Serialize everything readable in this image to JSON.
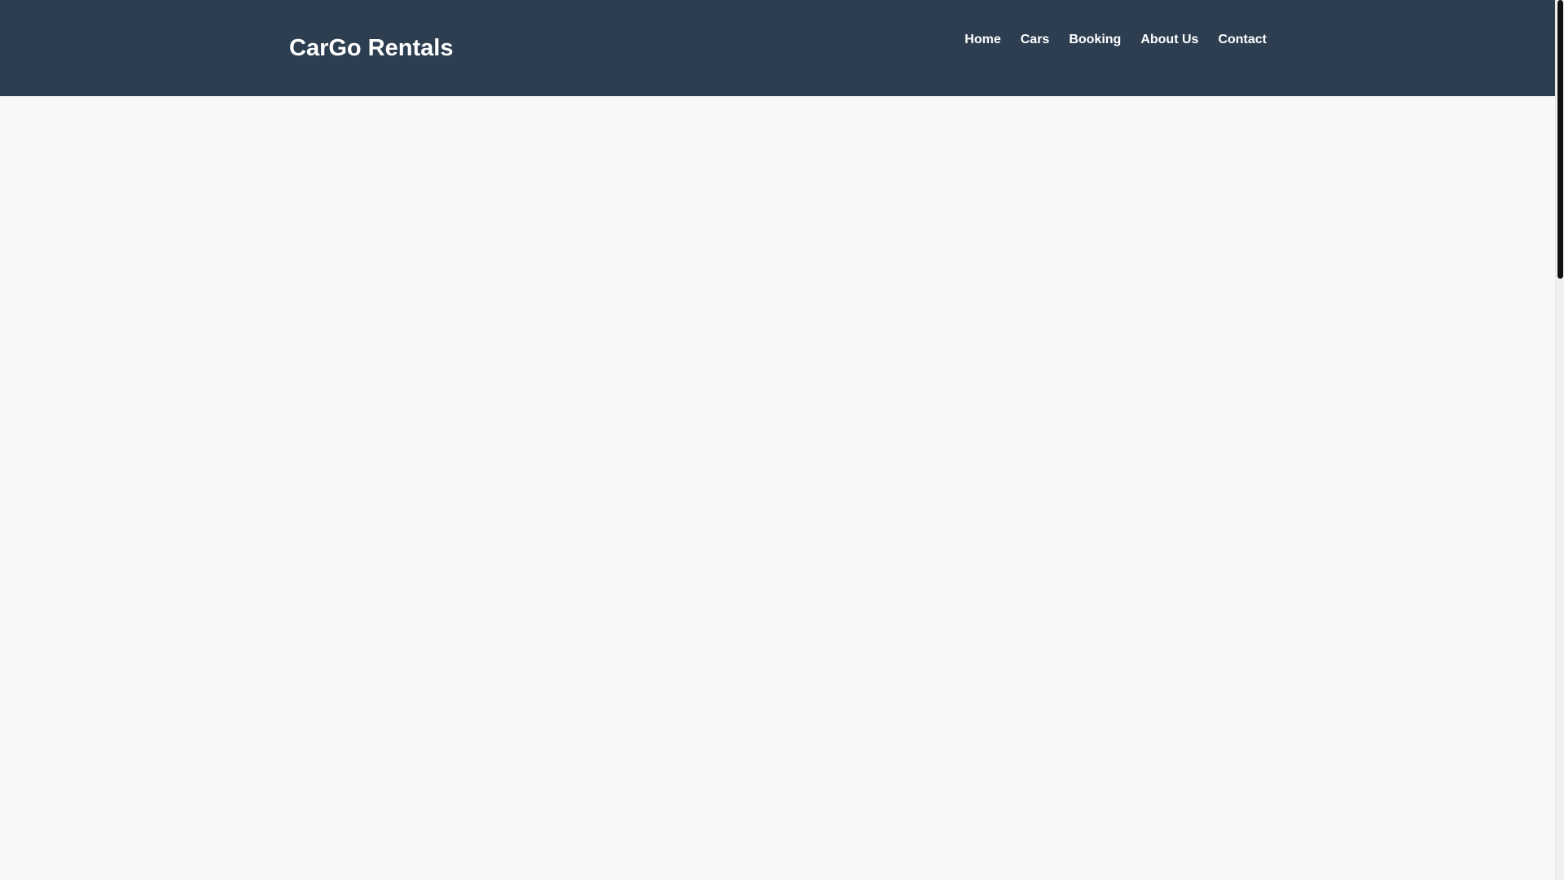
{
  "header": {
    "brand": "CarGo Rentals",
    "nav": [
      {
        "label": "Home"
      },
      {
        "label": "Cars"
      },
      {
        "label": "Booking"
      },
      {
        "label": "About Us"
      },
      {
        "label": "Contact"
      }
    ]
  },
  "colors": {
    "header_bg": "#2d3e51",
    "page_bg": "#f8f8f8",
    "header_text": "#ffffff",
    "scrollbar_thumb": "#111111"
  }
}
